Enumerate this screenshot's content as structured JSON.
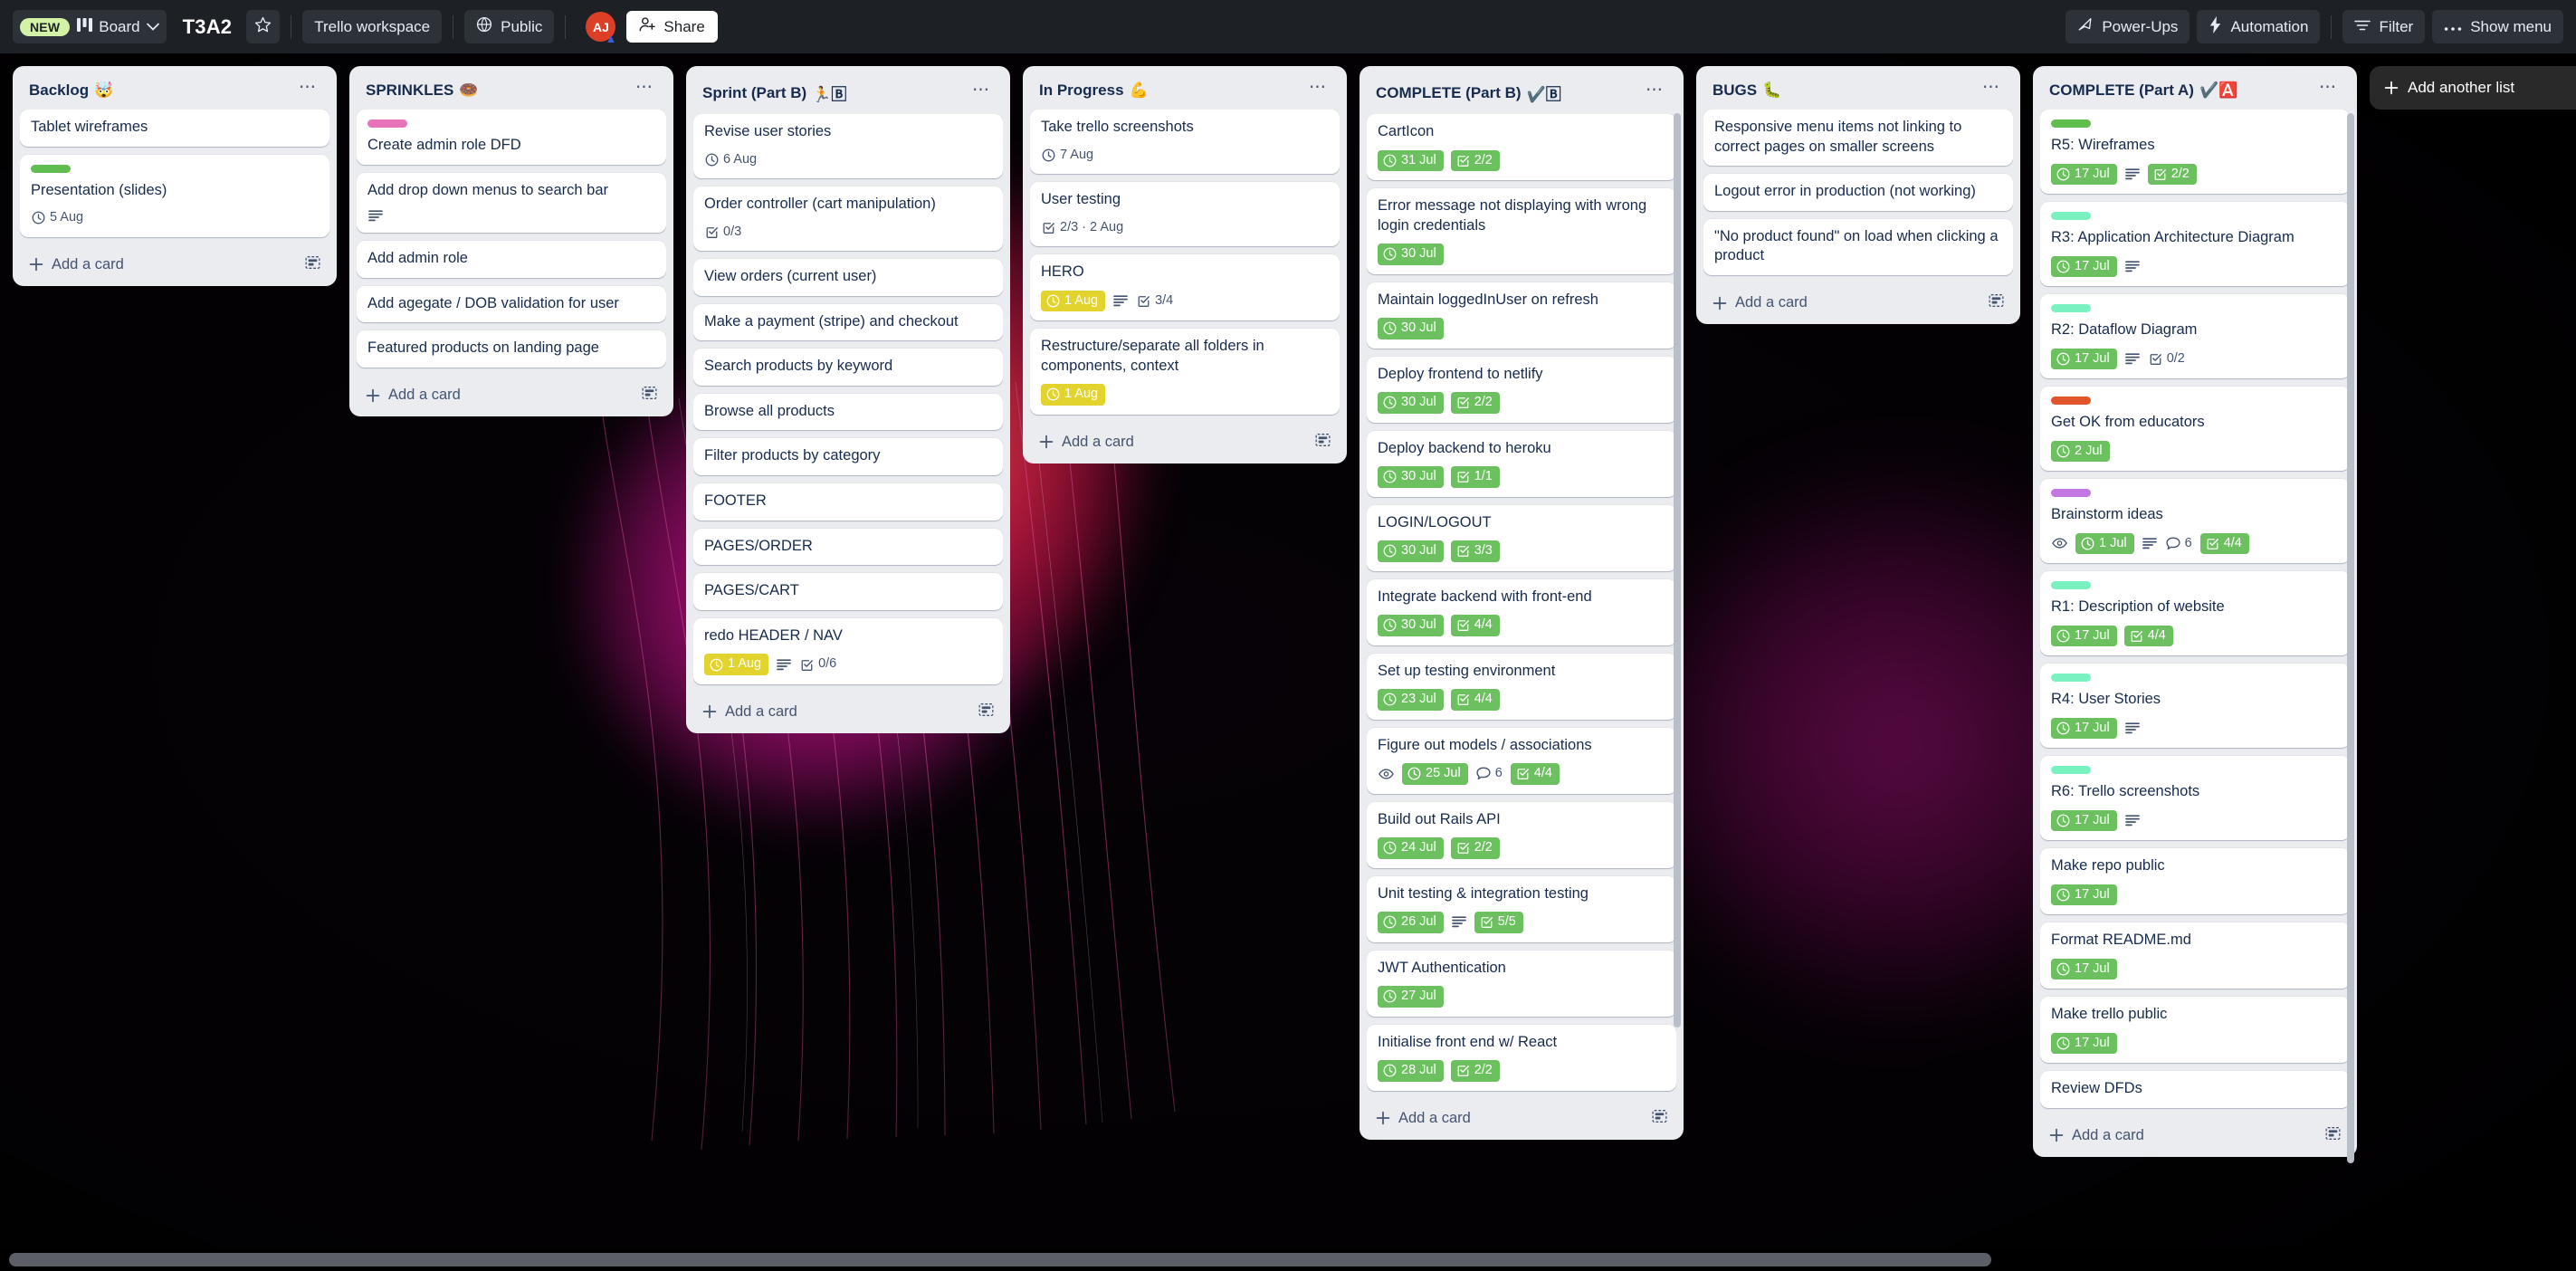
{
  "topbar": {
    "new_badge": "NEW",
    "board_label": "Board",
    "board_title": "T3A2",
    "workspace": "Trello workspace",
    "visibility": "Public",
    "avatar_initials": "AJ",
    "share_label": "Share",
    "powerups_label": "Power-Ups",
    "automation_label": "Automation",
    "filter_label": "Filter",
    "show_menu_label": "Show menu"
  },
  "board": {
    "add_list_label": "Add another list",
    "add_card_label": "Add a card",
    "lists": [
      {
        "title": "Backlog",
        "emoji": "🤯",
        "cards": [
          {
            "title": "Tablet wireframes",
            "label": null,
            "badges": []
          },
          {
            "title": "Presentation (slides)",
            "label": "#61bd4f",
            "badges": [
              {
                "type": "due",
                "color": "plain",
                "text": "5 Aug"
              }
            ]
          }
        ]
      },
      {
        "title": "SPRINKLES",
        "emoji": "🍩",
        "cards": [
          {
            "title": "Create admin role DFD",
            "label": "#e774bb",
            "badges": []
          },
          {
            "title": "Add drop down menus to search bar",
            "label": null,
            "badges": [
              {
                "type": "description"
              }
            ]
          },
          {
            "title": "Add admin role",
            "label": null,
            "badges": []
          },
          {
            "title": "Add agegate / DOB validation for user",
            "label": null,
            "badges": []
          },
          {
            "title": "Featured products on landing page",
            "label": null,
            "badges": []
          }
        ]
      },
      {
        "title": "Sprint (Part B)",
        "emoji": "🏃🄱",
        "cards": [
          {
            "title": "Revise user stories",
            "label": null,
            "badges": [
              {
                "type": "due",
                "color": "plain",
                "text": "6 Aug"
              }
            ]
          },
          {
            "title": "Order controller (cart manipulation)",
            "label": null,
            "badges": [
              {
                "type": "checklist",
                "color": "plain",
                "text": "0/3"
              }
            ]
          },
          {
            "title": "View orders (current user)",
            "label": null,
            "badges": []
          },
          {
            "title": "Make a payment (stripe) and checkout",
            "label": null,
            "badges": []
          },
          {
            "title": "Search products by keyword",
            "label": null,
            "badges": []
          },
          {
            "title": "Browse all products",
            "label": null,
            "badges": []
          },
          {
            "title": "Filter products by category",
            "label": null,
            "badges": []
          },
          {
            "title": "FOOTER",
            "label": null,
            "badges": []
          },
          {
            "title": "PAGES/ORDER",
            "label": null,
            "badges": []
          },
          {
            "title": "PAGES/CART",
            "label": null,
            "badges": []
          },
          {
            "title": "redo HEADER / NAV",
            "label": null,
            "badges": [
              {
                "type": "due",
                "color": "yellow",
                "text": "1 Aug"
              },
              {
                "type": "description"
              },
              {
                "type": "checklist",
                "color": "plain",
                "text": "0/6"
              }
            ]
          }
        ]
      },
      {
        "title": "In Progress",
        "emoji": "💪",
        "cards": [
          {
            "title": "Take trello screenshots",
            "label": null,
            "badges": [
              {
                "type": "due",
                "color": "plain",
                "text": "7 Aug"
              }
            ]
          },
          {
            "title": "User testing",
            "label": null,
            "badges": [
              {
                "type": "checklist",
                "color": "plain",
                "text": "2/3 · 2 Aug"
              }
            ]
          },
          {
            "title": "HERO",
            "label": null,
            "badges": [
              {
                "type": "due",
                "color": "yellow",
                "text": "1 Aug"
              },
              {
                "type": "description"
              },
              {
                "type": "checklist",
                "color": "plain",
                "text": "3/4"
              }
            ]
          },
          {
            "title": "Restructure/separate all folders in components, context",
            "label": null,
            "badges": [
              {
                "type": "due",
                "color": "yellow",
                "text": "1 Aug"
              }
            ]
          }
        ]
      },
      {
        "title": "COMPLETE (Part B)",
        "emoji": "✔️🄱",
        "scrolling": true,
        "cards": [
          {
            "title": "CartIcon",
            "label": null,
            "badges": [
              {
                "type": "due",
                "color": "green",
                "text": "31 Jul"
              },
              {
                "type": "checklist",
                "color": "green",
                "text": "2/2"
              }
            ]
          },
          {
            "title": "Error message not displaying with wrong login credentials",
            "label": null,
            "badges": [
              {
                "type": "due",
                "color": "green",
                "text": "30 Jul"
              }
            ]
          },
          {
            "title": "Maintain loggedInUser on refresh",
            "label": null,
            "badges": [
              {
                "type": "due",
                "color": "green",
                "text": "30 Jul"
              }
            ]
          },
          {
            "title": "Deploy frontend to netlify",
            "label": null,
            "badges": [
              {
                "type": "due",
                "color": "green",
                "text": "30 Jul"
              },
              {
                "type": "checklist",
                "color": "green",
                "text": "2/2"
              }
            ]
          },
          {
            "title": "Deploy backend to heroku",
            "label": null,
            "badges": [
              {
                "type": "due",
                "color": "green",
                "text": "30 Jul"
              },
              {
                "type": "checklist",
                "color": "green",
                "text": "1/1"
              }
            ]
          },
          {
            "title": "LOGIN/LOGOUT",
            "label": null,
            "badges": [
              {
                "type": "due",
                "color": "green",
                "text": "30 Jul"
              },
              {
                "type": "checklist",
                "color": "green",
                "text": "3/3"
              }
            ]
          },
          {
            "title": "Integrate backend with front-end",
            "label": null,
            "badges": [
              {
                "type": "due",
                "color": "green",
                "text": "30 Jul"
              },
              {
                "type": "checklist",
                "color": "green",
                "text": "4/4"
              }
            ]
          },
          {
            "title": "Set up testing environment",
            "label": null,
            "badges": [
              {
                "type": "due",
                "color": "green",
                "text": "23 Jul"
              },
              {
                "type": "checklist",
                "color": "green",
                "text": "4/4"
              }
            ]
          },
          {
            "title": "Figure out models / associations",
            "label": null,
            "badges": [
              {
                "type": "watch"
              },
              {
                "type": "due",
                "color": "green",
                "text": "25 Jul"
              },
              {
                "type": "comments",
                "color": "plain",
                "text": "6"
              },
              {
                "type": "checklist",
                "color": "green",
                "text": "4/4"
              }
            ]
          },
          {
            "title": "Build out Rails API",
            "label": null,
            "badges": [
              {
                "type": "due",
                "color": "green",
                "text": "24 Jul"
              },
              {
                "type": "checklist",
                "color": "green",
                "text": "2/2"
              }
            ]
          },
          {
            "title": "Unit testing & integration testing",
            "label": null,
            "badges": [
              {
                "type": "due",
                "color": "green",
                "text": "26 Jul"
              },
              {
                "type": "description"
              },
              {
                "type": "checklist",
                "color": "green",
                "text": "5/5"
              }
            ]
          },
          {
            "title": "JWT Authentication",
            "label": null,
            "badges": [
              {
                "type": "due",
                "color": "green",
                "text": "27 Jul"
              }
            ]
          },
          {
            "title": "Initialise front end w/ React",
            "label": null,
            "badges": [
              {
                "type": "due",
                "color": "green",
                "text": "28 Jul"
              },
              {
                "type": "checklist",
                "color": "green",
                "text": "2/2"
              }
            ]
          }
        ]
      },
      {
        "title": "BUGS",
        "emoji": "🐛",
        "cards": [
          {
            "title": "Responsive menu items not linking to correct pages on smaller screens",
            "label": null,
            "badges": []
          },
          {
            "title": "Logout error in production (not working)",
            "label": null,
            "badges": []
          },
          {
            "title": "\"No product found\" on load when clicking a product",
            "label": null,
            "badges": []
          }
        ]
      },
      {
        "title": "COMPLETE (Part A)",
        "emoji": "✔️🅰️",
        "scrolling": true,
        "cards": [
          {
            "title": "R5: Wireframes",
            "label": "#61bd4f",
            "badges": [
              {
                "type": "due",
                "color": "green",
                "text": "17 Jul"
              },
              {
                "type": "description"
              },
              {
                "type": "checklist",
                "color": "green",
                "text": "2/2"
              }
            ]
          },
          {
            "title": "R3: Application Architecture Diagram",
            "label": "#79f2c0",
            "badges": [
              {
                "type": "due",
                "color": "green",
                "text": "17 Jul"
              },
              {
                "type": "description"
              }
            ]
          },
          {
            "title": "R2: Dataflow Diagram",
            "label": "#79f2c0",
            "badges": [
              {
                "type": "due",
                "color": "green",
                "text": "17 Jul"
              },
              {
                "type": "description"
              },
              {
                "type": "checklist",
                "color": "plain",
                "text": "0/2"
              }
            ]
          },
          {
            "title": "Get OK from educators",
            "label": "#e2542c",
            "badges": [
              {
                "type": "due",
                "color": "green",
                "text": "2 Jul"
              }
            ]
          },
          {
            "title": "Brainstorm ideas",
            "label": "#c377e0",
            "badges": [
              {
                "type": "watch"
              },
              {
                "type": "due",
                "color": "green",
                "text": "1 Jul"
              },
              {
                "type": "description"
              },
              {
                "type": "comments",
                "color": "plain",
                "text": "6"
              },
              {
                "type": "checklist",
                "color": "green",
                "text": "4/4"
              }
            ]
          },
          {
            "title": "R1: Description of website",
            "label": "#79f2c0",
            "badges": [
              {
                "type": "due",
                "color": "green",
                "text": "17 Jul"
              },
              {
                "type": "checklist",
                "color": "green",
                "text": "4/4"
              }
            ]
          },
          {
            "title": "R4: User Stories",
            "label": "#79f2c0",
            "badges": [
              {
                "type": "due",
                "color": "green",
                "text": "17 Jul"
              },
              {
                "type": "description"
              }
            ]
          },
          {
            "title": "R6: Trello screenshots",
            "label": "#79f2c0",
            "badges": [
              {
                "type": "due",
                "color": "green",
                "text": "17 Jul"
              },
              {
                "type": "description"
              }
            ]
          },
          {
            "title": "Make repo public",
            "label": null,
            "badges": [
              {
                "type": "due",
                "color": "green",
                "text": "17 Jul"
              }
            ]
          },
          {
            "title": "Format README.md",
            "label": null,
            "badges": [
              {
                "type": "due",
                "color": "green",
                "text": "17 Jul"
              }
            ]
          },
          {
            "title": "Make trello public",
            "label": null,
            "badges": [
              {
                "type": "due",
                "color": "green",
                "text": "17 Jul"
              }
            ]
          },
          {
            "title": "Review DFDs",
            "label": null,
            "badges": []
          }
        ]
      }
    ]
  }
}
